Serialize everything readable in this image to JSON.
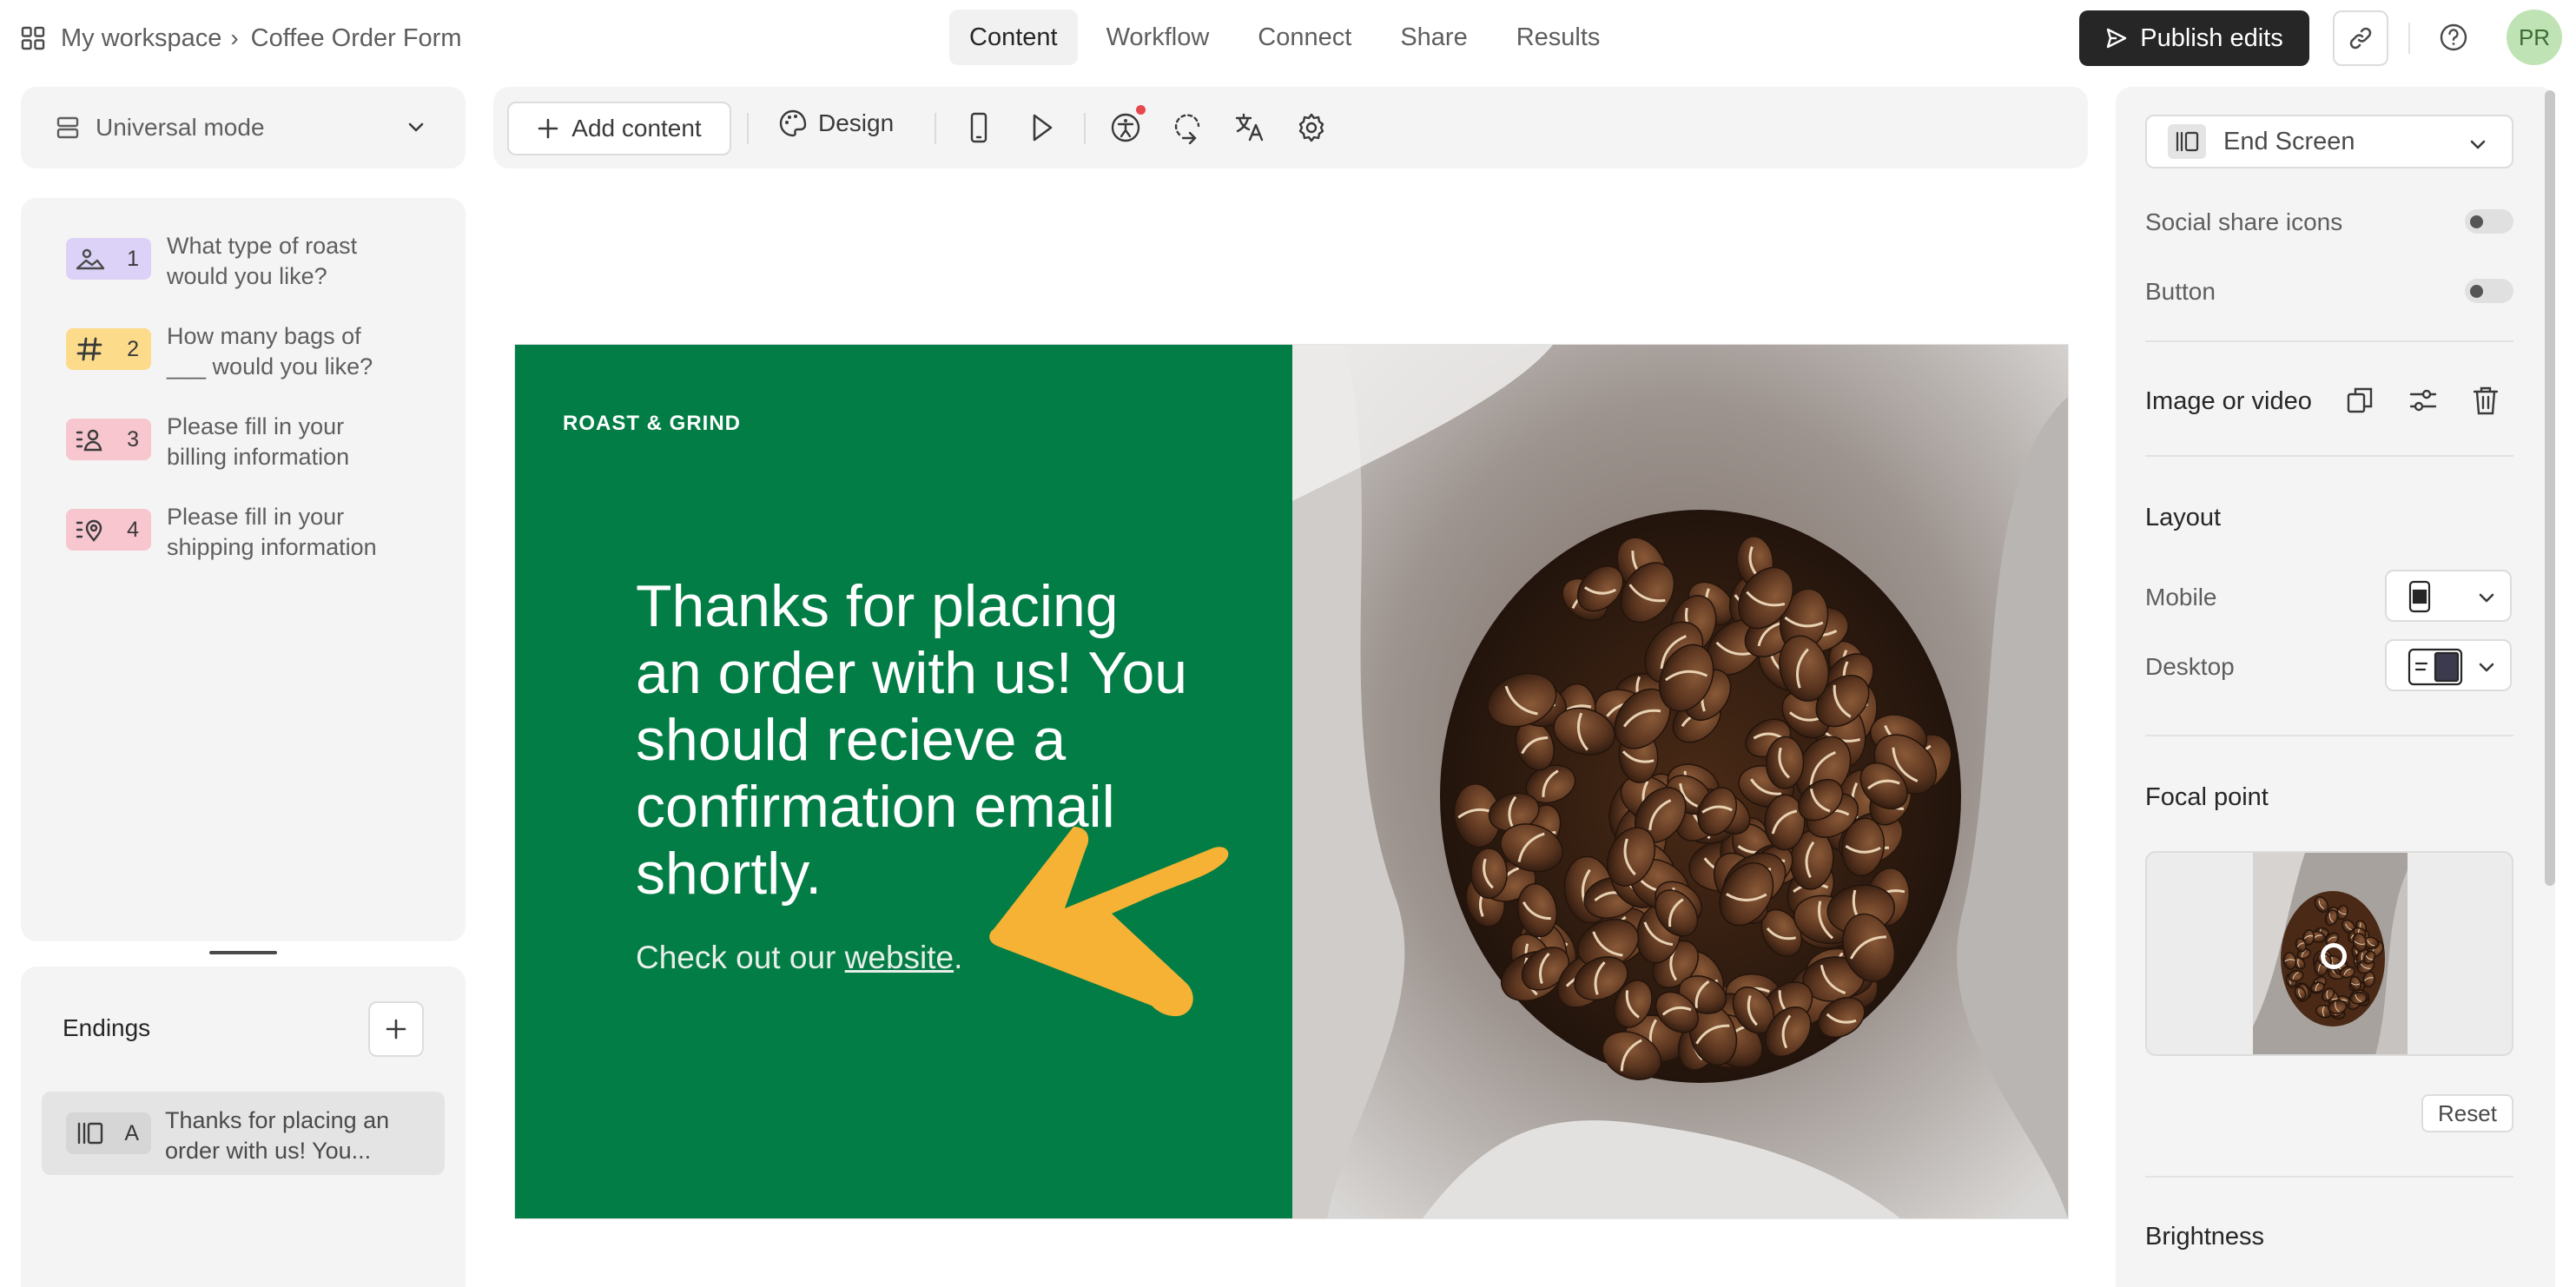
{
  "header": {
    "workspace": "My workspace",
    "separator": "›",
    "form_name": "Coffee Order Form",
    "tabs": [
      {
        "label": "Content",
        "active": true
      },
      {
        "label": "Workflow"
      },
      {
        "label": "Connect"
      },
      {
        "label": "Share"
      },
      {
        "label": "Results"
      }
    ],
    "publish_label": "Publish edits",
    "avatar_initials": "PR"
  },
  "left": {
    "mode_label": "Universal mode",
    "questions": [
      {
        "num": "1",
        "text": "What type of roast would you like?",
        "color": "#dcd2f7",
        "icon": "picture-choice-icon"
      },
      {
        "num": "2",
        "text": "How many bags of ___ would you like?",
        "color": "#fcdb8b",
        "icon": "hash-icon"
      },
      {
        "num": "3",
        "text": "Please fill in your billing information",
        "color": "#f7c6cf",
        "icon": "contact-info-icon"
      },
      {
        "num": "4",
        "text": "Please fill in your shipping information",
        "color": "#f7c6cf",
        "icon": "address-icon"
      }
    ],
    "endings_title": "Endings",
    "endings": [
      {
        "letter": "A",
        "text": "Thanks for placing an order with us! You..."
      }
    ]
  },
  "toolbar": {
    "add_content": "Add content",
    "design": "Design"
  },
  "slide": {
    "logo": "ROAST & GRIND",
    "heading": "Thanks for placing an order with us! You should recieve a confirmation email shortly.",
    "sub_prefix": "Check out our ",
    "sub_link": "website",
    "sub_suffix": ".",
    "bg_color": "#027d45",
    "arrow_color": "#f5b234"
  },
  "right": {
    "end_screen": "End Screen",
    "social_share": "Social share icons",
    "button": "Button",
    "image_or_video": "Image or video",
    "layout": "Layout",
    "mobile": "Mobile",
    "desktop": "Desktop",
    "focal_point": "Focal point",
    "reset": "Reset",
    "brightness": "Brightness"
  }
}
